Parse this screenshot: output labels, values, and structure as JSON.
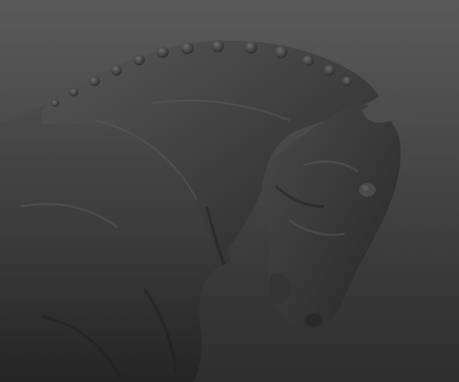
{
  "scene": {
    "subject_icon": "sculpted-horse-icon",
    "background_color_top": "#5a5a5a",
    "background_color_bottom": "#2e2e2e",
    "material_color": "#3b3b3b",
    "highlight_color": "#5d5d5d",
    "shadow_color": "#1f1f1f"
  }
}
